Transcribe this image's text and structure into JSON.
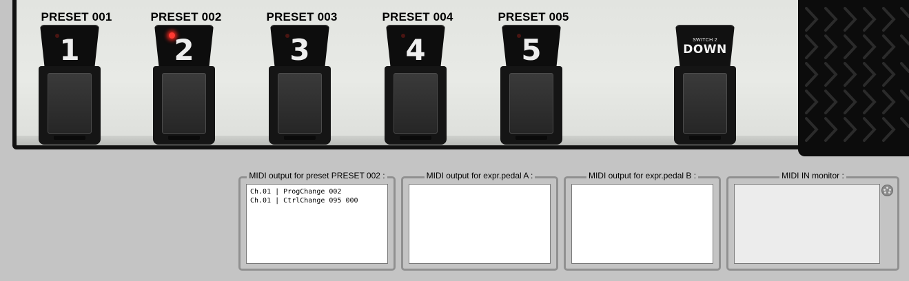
{
  "presets": [
    {
      "label": "PRESET 001",
      "number": "1",
      "led": false
    },
    {
      "label": "PRESET 002",
      "number": "2",
      "led": true
    },
    {
      "label": "PRESET 003",
      "number": "3",
      "led": false
    },
    {
      "label": "PRESET 004",
      "number": "4",
      "led": false
    },
    {
      "label": "PRESET 005",
      "number": "5",
      "led": false
    }
  ],
  "switch_down": {
    "small_label": "SWITCH 2",
    "big_label": "DOWN"
  },
  "midi_panels": {
    "preset_output": {
      "title": "MIDI output for preset PRESET 002 :",
      "lines": [
        "Ch.01 | ProgChange 002",
        "Ch.01 | CtrlChange 095 000"
      ]
    },
    "expr_a": {
      "title": "MIDI output for expr.pedal A :"
    },
    "expr_b": {
      "title": "MIDI output for expr.pedal B :"
    },
    "midi_in": {
      "title": "MIDI IN monitor :"
    }
  },
  "colors": {
    "led_on": "#ff3a32",
    "background": "#c4c4c4",
    "panel": "#e2e4e0"
  },
  "icons": {
    "midi_in": "midi-port-icon"
  }
}
